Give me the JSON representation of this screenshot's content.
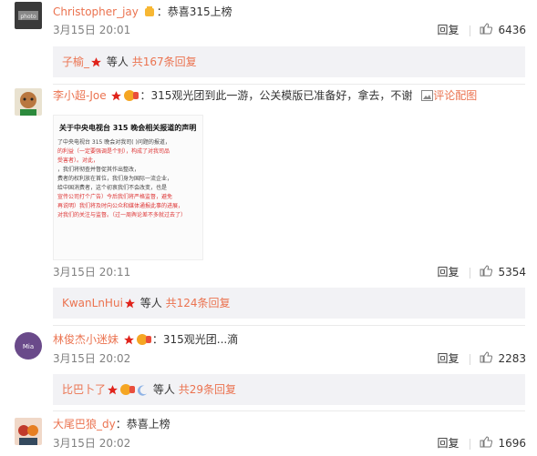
{
  "comments": [
    {
      "user": "Christopher_jay",
      "text": "恭喜315上榜",
      "date": "3月15日 20:01",
      "reply_label": "回复",
      "likes": "6436",
      "replies": {
        "names": "子榆_",
        "suffix": "等人",
        "count_text": "共167条回复"
      }
    },
    {
      "user": "李小超-Joe",
      "text": "315观光团到此一游，公关模版已准备好，拿去，不谢",
      "pic_label": "评论配图",
      "date": "3月15日 20:11",
      "reply_label": "回复",
      "likes": "5354",
      "replies": {
        "names": "KwanLnHui",
        "suffix": "等人",
        "count_text": "共124条回复"
      },
      "embedded_image": {
        "title": "关于中央电视台 315 晚会相关报道的声明",
        "lines": [
          "了中央电视台 315 晚会对我司(        )问题的报道，",
          "的利益（一定要强调是个别），构成了对我司品",
          "受害者）。对此，",
          "，我们将彻查并督促其作出整改，",
          "费者的权利放在首位，我们身为国际一流企业，",
          "给中国消费者，这个初衷我们不会改变，也是",
          "宣传公司打个广告）今后我们将严格监督，避免",
          "再说明）我们将及时向公众和媒体通报此事的进展，",
          "对我们的关注与监督。（过一周舆论差不多就过去了）"
        ]
      }
    },
    {
      "user": "林俊杰小迷妹",
      "text": "315观光团...滴",
      "date": "3月15日 20:02",
      "reply_label": "回复",
      "likes": "2283",
      "replies": {
        "names": "比巴卜了",
        "suffix": "等人",
        "count_text": "共29条回复"
      }
    },
    {
      "user": "大尾巴狼_dy",
      "text": "恭喜上榜",
      "date": "3月15日 20:02",
      "reply_label": "回复",
      "likes": "1696"
    }
  ],
  "colors": {
    "accent": "#eb7350",
    "reply_bg": "#f2f2f5",
    "date": "#808080"
  }
}
